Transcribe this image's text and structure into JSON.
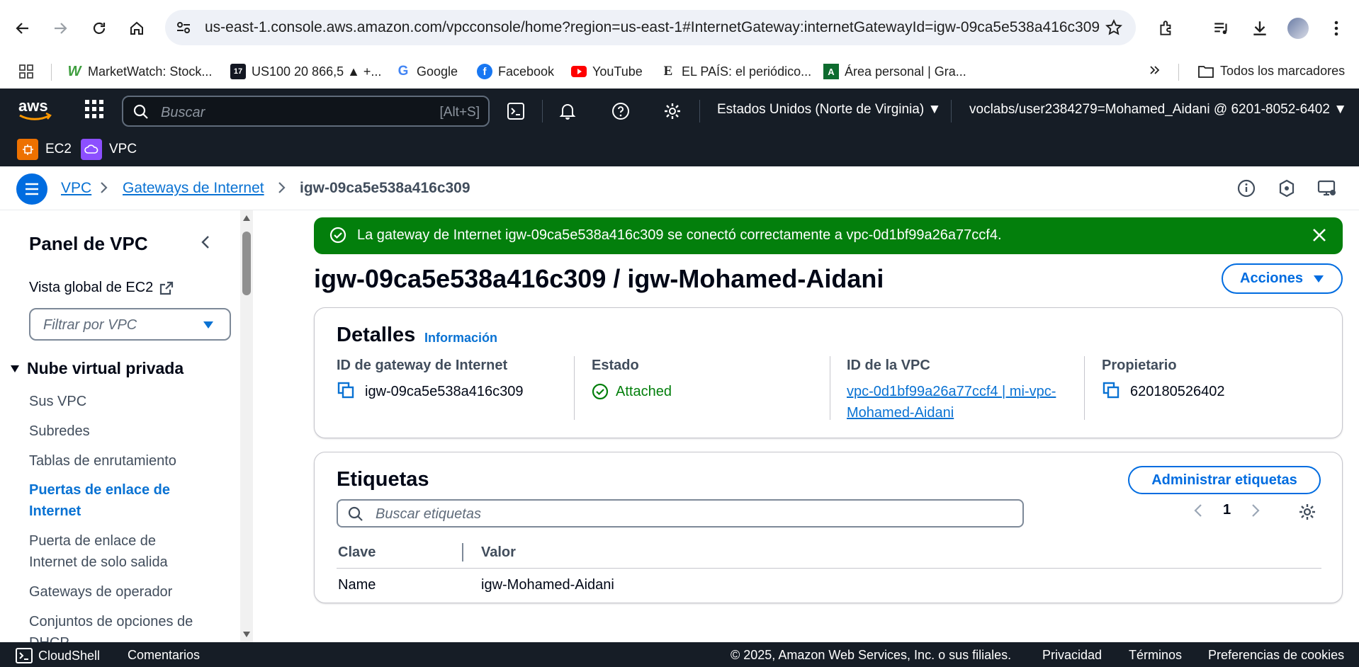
{
  "browser": {
    "url": "us-east-1.console.aws.amazon.com/vpcconsole/home?region=us-east-1#InternetGateway:internetGatewayId=igw-09ca5e538a416c309",
    "bookmarks": [
      {
        "label": "MarketWatch: Stock...",
        "icon": "marketwatch-icon"
      },
      {
        "label": "US100 20 866,5 ▲ +...",
        "icon": "tradingview-icon"
      },
      {
        "label": "Google",
        "icon": "google-icon"
      },
      {
        "label": "Facebook",
        "icon": "facebook-icon"
      },
      {
        "label": "YouTube",
        "icon": "youtube-icon"
      },
      {
        "label": "EL PAÍS: el periódico...",
        "icon": "elpais-icon"
      },
      {
        "label": "Área personal | Gra...",
        "icon": "area-personal-icon"
      }
    ],
    "all_bookmarks": "Todos los marcadores"
  },
  "aws": {
    "search_placeholder": "Buscar",
    "search_shortcut": "[Alt+S]",
    "region": "Estados Unidos (Norte de Virginia)",
    "account": "voclabs/user2384279=Mohamed_Aidani @ 6201-8052-6402",
    "services": [
      {
        "label": "EC2",
        "color": "#ed7100"
      },
      {
        "label": "VPC",
        "color": "#8c4fff"
      }
    ]
  },
  "breadcrumb": {
    "root": "VPC",
    "section": "Gateways de Internet",
    "current": "igw-09ca5e538a416c309"
  },
  "sidebar": {
    "title": "Panel de VPC",
    "global_view": "Vista global de EC2",
    "filter_placeholder": "Filtrar por VPC",
    "section": "Nube virtual privada",
    "items": [
      {
        "label": "Sus VPC"
      },
      {
        "label": "Subredes"
      },
      {
        "label": "Tablas de enrutamiento"
      },
      {
        "label": "Puertas de enlace de Internet",
        "active": true
      },
      {
        "label": "Puerta de enlace de Internet de solo salida"
      },
      {
        "label": "Gateways de operador"
      },
      {
        "label": "Conjuntos de opciones de DHCP"
      }
    ]
  },
  "flash": {
    "message": "La gateway de Internet igw-09ca5e538a416c309 se conectó correctamente a vpc-0d1bf99a26a77ccf4."
  },
  "page": {
    "title": "igw-09ca5e538a416c309 / igw-Mohamed-Aidani",
    "actions": "Acciones"
  },
  "details": {
    "heading": "Detalles",
    "info": "Información",
    "gateway_id_label": "ID de gateway de Internet",
    "gateway_id": "igw-09ca5e538a416c309",
    "state_label": "Estado",
    "state": "Attached",
    "vpc_id_label": "ID de la VPC",
    "vpc_id": "vpc-0d1bf99a26a77ccf4 | mi-vpc-Mohamed-Aidani",
    "owner_label": "Propietario",
    "owner": "620180526402"
  },
  "tags": {
    "heading": "Etiquetas",
    "manage": "Administrar etiquetas",
    "search_placeholder": "Buscar etiquetas",
    "page": "1",
    "columns": [
      "Clave",
      "Valor"
    ],
    "rows": [
      {
        "key": "Name",
        "value": "igw-Mohamed-Aidani"
      }
    ]
  },
  "footer": {
    "cloudshell": "CloudShell",
    "feedback": "Comentarios",
    "copyright": "© 2025, Amazon Web Services, Inc. o sus filiales.",
    "privacy": "Privacidad",
    "terms": "Términos",
    "cookies": "Preferencias de cookies"
  }
}
